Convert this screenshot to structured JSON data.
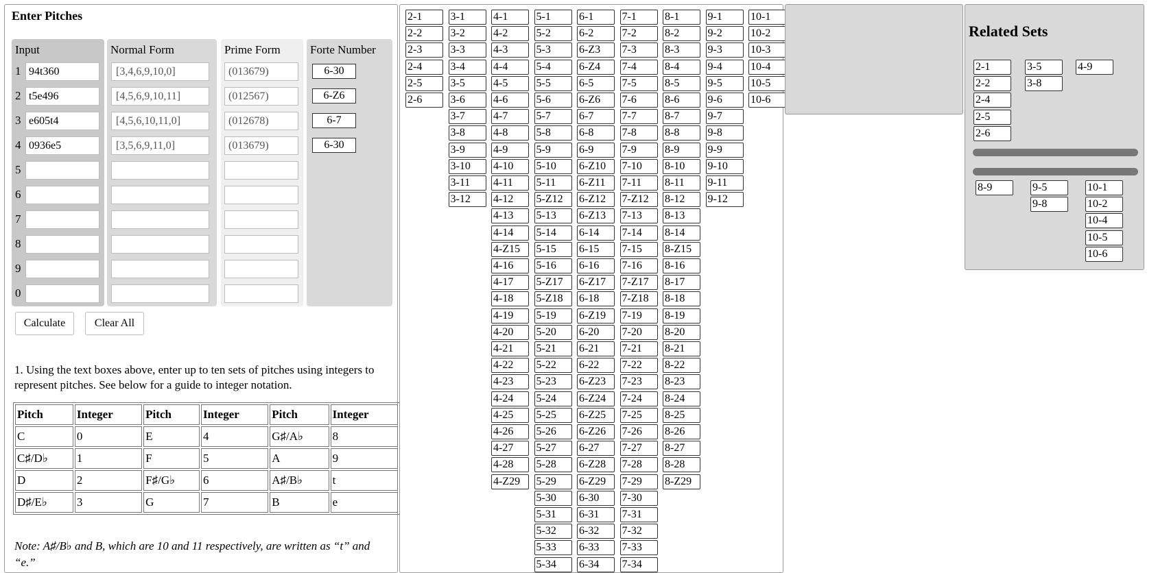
{
  "enter_panel": {
    "title": "Enter Pitches",
    "columns": {
      "input": "Input",
      "normal": "Normal Form",
      "prime": "Prime Form",
      "forte": "Forte Number"
    },
    "rows": [
      {
        "num": "1",
        "input": "94t360",
        "normal": "[3,4,6,9,10,0]",
        "prime": "(013679)",
        "forte": "6-30"
      },
      {
        "num": "2",
        "input": "t5e496",
        "normal": "[4,5,6,9,10,11]",
        "prime": "(012567)",
        "forte": "6-Z6"
      },
      {
        "num": "3",
        "input": "e605t4",
        "normal": "[4,5,6,10,11,0]",
        "prime": "(012678)",
        "forte": "6-7"
      },
      {
        "num": "4",
        "input": "0936e5",
        "normal": "[3,5,6,9,11,0]",
        "prime": "(013679)",
        "forte": "6-30"
      },
      {
        "num": "5",
        "input": "",
        "normal": "",
        "prime": "",
        "forte": ""
      },
      {
        "num": "6",
        "input": "",
        "normal": "",
        "prime": "",
        "forte": ""
      },
      {
        "num": "7",
        "input": "",
        "normal": "",
        "prime": "",
        "forte": ""
      },
      {
        "num": "8",
        "input": "",
        "normal": "",
        "prime": "",
        "forte": ""
      },
      {
        "num": "9",
        "input": "",
        "normal": "",
        "prime": "",
        "forte": ""
      },
      {
        "num": "0",
        "input": "",
        "normal": "",
        "prime": "",
        "forte": ""
      }
    ],
    "calculate_label": "Calculate",
    "clear_label": "Clear All",
    "instructions": "1. Using the text boxes above, enter up to ten sets of pitches using integers to represent pitches. See below for a guide to integer notation.",
    "table": {
      "headers": [
        "Pitch",
        "Integer",
        "Pitch",
        "Integer",
        "Pitch",
        "Integer"
      ],
      "rows": [
        [
          "C",
          "0",
          "E",
          "4",
          "G♯/A♭",
          "8"
        ],
        [
          "C♯/D♭",
          "1",
          "F",
          "5",
          "A",
          "9"
        ],
        [
          "D",
          "2",
          "F♯/G♭",
          "6",
          "A♯/B♭",
          "t"
        ],
        [
          "D♯/E♭",
          "3",
          "G",
          "7",
          "B",
          "e"
        ]
      ]
    },
    "note": "Note: A♯/B♭ and B, which are 10 and 11 respectively, are written as “t” and “e.”"
  },
  "set_columns": [
    [
      "2-1",
      "2-2",
      "2-3",
      "2-4",
      "2-5",
      "2-6"
    ],
    [
      "3-1",
      "3-2",
      "3-3",
      "3-4",
      "3-5",
      "3-6",
      "3-7",
      "3-8",
      "3-9",
      "3-10",
      "3-11",
      "3-12"
    ],
    [
      "4-1",
      "4-2",
      "4-3",
      "4-4",
      "4-5",
      "4-6",
      "4-7",
      "4-8",
      "4-9",
      "4-10",
      "4-11",
      "4-12",
      "4-13",
      "4-14",
      "4-Z15",
      "4-16",
      "4-17",
      "4-18",
      "4-19",
      "4-20",
      "4-21",
      "4-22",
      "4-23",
      "4-24",
      "4-25",
      "4-26",
      "4-27",
      "4-28",
      "4-Z29"
    ],
    [
      "5-1",
      "5-2",
      "5-3",
      "5-4",
      "5-5",
      "5-6",
      "5-7",
      "5-8",
      "5-9",
      "5-10",
      "5-11",
      "5-Z12",
      "5-13",
      "5-14",
      "5-15",
      "5-16",
      "5-Z17",
      "5-Z18",
      "5-19",
      "5-20",
      "5-21",
      "5-22",
      "5-23",
      "5-24",
      "5-25",
      "5-26",
      "5-27",
      "5-28",
      "5-29",
      "5-30",
      "5-31",
      "5-32",
      "5-33",
      "5-34"
    ],
    [
      "6-1",
      "6-2",
      "6-Z3",
      "6-Z4",
      "6-5",
      "6-Z6",
      "6-7",
      "6-8",
      "6-9",
      "6-Z10",
      "6-Z11",
      "6-Z12",
      "6-Z13",
      "6-14",
      "6-15",
      "6-16",
      "6-Z17",
      "6-18",
      "6-Z19",
      "6-20",
      "6-21",
      "6-22",
      "6-Z23",
      "6-Z24",
      "6-Z25",
      "6-Z26",
      "6-27",
      "6-Z28",
      "6-Z29",
      "6-30",
      "6-31",
      "6-32",
      "6-33",
      "6-34"
    ],
    [
      "7-1",
      "7-2",
      "7-3",
      "7-4",
      "7-5",
      "7-6",
      "7-7",
      "7-8",
      "7-9",
      "7-10",
      "7-11",
      "7-Z12",
      "7-13",
      "7-14",
      "7-15",
      "7-16",
      "7-Z17",
      "7-Z18",
      "7-19",
      "7-20",
      "7-21",
      "7-22",
      "7-23",
      "7-24",
      "7-25",
      "7-26",
      "7-27",
      "7-28",
      "7-29",
      "7-30",
      "7-31",
      "7-32",
      "7-33",
      "7-34"
    ],
    [
      "8-1",
      "8-2",
      "8-3",
      "8-4",
      "8-5",
      "8-6",
      "8-7",
      "8-8",
      "8-9",
      "8-10",
      "8-11",
      "8-12",
      "8-13",
      "8-14",
      "8-Z15",
      "8-16",
      "8-17",
      "8-18",
      "8-19",
      "8-20",
      "8-21",
      "8-22",
      "8-23",
      "8-24",
      "8-25",
      "8-26",
      "8-27",
      "8-28",
      "8-Z29"
    ],
    [
      "9-1",
      "9-2",
      "9-3",
      "9-4",
      "9-5",
      "9-6",
      "9-7",
      "9-8",
      "9-9",
      "9-10",
      "9-11",
      "9-12"
    ],
    [
      "10-1",
      "10-2",
      "10-3",
      "10-4",
      "10-5",
      "10-6"
    ]
  ],
  "related_panel": {
    "title": "Related Sets",
    "group_top": [
      [
        "2-1",
        "2-2",
        "2-4",
        "2-5",
        "2-6"
      ],
      [
        "3-5",
        "3-8"
      ],
      [
        "4-9"
      ]
    ],
    "group_bottom": [
      [
        "8-9"
      ],
      [
        "9-5",
        "9-8"
      ],
      [
        "10-1",
        "10-2",
        "10-4",
        "10-5",
        "10-6"
      ]
    ]
  }
}
